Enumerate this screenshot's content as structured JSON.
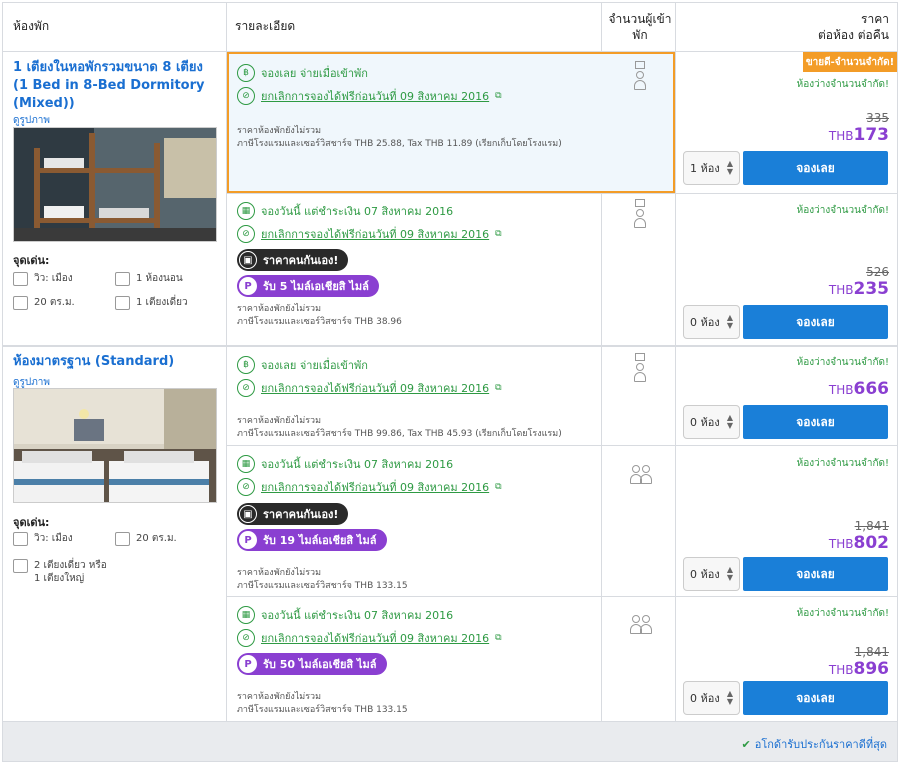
{
  "headers": {
    "room": "ห้องพัก",
    "details": "รายละเอียด",
    "guests": "จำนวนผู้เข้าพัก",
    "price_line1": "ราคา",
    "price_line2": "ต่อห้อง ต่อคืน"
  },
  "rooms": [
    {
      "title": "1 เตียงในหอพักรวมขนาด 8 เตียง (1 Bed in 8-Bed Dormitory (Mixed))",
      "photos_link": "ดูรูปภาพ",
      "features_title": "จุดเด่น:",
      "features": [
        "วิว: เมือง",
        "1 ห้องนอน",
        "20 ตร.ม.",
        "1 เตียงเดี่ยว"
      ]
    },
    {
      "title": "ห้องมาตรฐาน (Standard)",
      "photos_link": "ดูรูปภาพ",
      "features_title": "จุดเด่น:",
      "features": [
        "วิว: เมือง",
        "20 ตร.ม.",
        "2 เตียงเดี่ยว หรือ 1 เตียงใหญ่"
      ]
    }
  ],
  "offers": [
    {
      "opt1": "จองเลย จ่ายเมื่อเข้าพัก",
      "opt2": "ยกเลิกการจองได้ฟรีก่อนวันที่ 09 สิงหาคม 2016",
      "fine1": "ราคาห้องพักยังไม่รวม",
      "fine2": "ภาษีโรงแรมและเซอร์วิสชาร์จ THB 25.88, Tax THB 11.89 (เรียกเก็บโดยโรงแรม)",
      "badge": "ขายดี-จำนวนจำกัด!",
      "avail": "ห้องว่างจำนวนจำกัด!",
      "old_price": "335",
      "currency": "THB",
      "price": "173",
      "qty": "1 ห้อง",
      "button": "จองเลย"
    },
    {
      "opt1": "จองวันนี้ แต่ชำระเงิน 07 สิงหาคม 2016",
      "opt2": "ยกเลิกการจองได้ฟรีก่อนวันที่ 09 สิงหาคม 2016",
      "pill_dark": "ราคาคนกันเอง!",
      "pill_purple": "รับ 5 ไมล์เอเชียสิ ไมล์",
      "fine1": "ราคาห้องพักยังไม่รวม",
      "fine2": "ภาษีโรงแรมและเซอร์วิสชาร์จ THB 38.96",
      "avail": "ห้องว่างจำนวนจำกัด!",
      "old_price": "526",
      "currency": "THB",
      "price": "235",
      "qty": "0 ห้อง",
      "button": "จองเลย"
    },
    {
      "opt1": "จองเลย จ่ายเมื่อเข้าพัก",
      "opt2": "ยกเลิกการจองได้ฟรีก่อนวันที่ 09 สิงหาคม 2016",
      "fine1": "ราคาห้องพักยังไม่รวม",
      "fine2": "ภาษีโรงแรมและเซอร์วิสชาร์จ THB 99.86, Tax THB 45.93 (เรียกเก็บโดยโรงแรม)",
      "avail": "ห้องว่างจำนวนจำกัด!",
      "currency": "THB",
      "price": "666",
      "qty": "0 ห้อง",
      "button": "จองเลย"
    },
    {
      "opt1": "จองวันนี้ แต่ชำระเงิน 07 สิงหาคม 2016",
      "opt2": "ยกเลิกการจองได้ฟรีก่อนวันที่ 09 สิงหาคม 2016",
      "pill_dark": "ราคาคนกันเอง!",
      "pill_purple": "รับ 19 ไมล์เอเชียสิ ไมล์",
      "fine1": "ราคาห้องพักยังไม่รวม",
      "fine2": "ภาษีโรงแรมและเซอร์วิสชาร์จ THB 133.15",
      "avail": "ห้องว่างจำนวนจำกัด!",
      "old_price": "1,841",
      "currency": "THB",
      "price": "802",
      "qty": "0 ห้อง",
      "button": "จองเลย"
    },
    {
      "opt1": "จองวันนี้ แต่ชำระเงิน 07 สิงหาคม 2016",
      "opt2": "ยกเลิกการจองได้ฟรีก่อนวันที่ 09 สิงหาคม 2016",
      "pill_purple": "รับ 50 ไมล์เอเชียสิ ไมล์",
      "fine1": "ราคาห้องพักยังไม่รวม",
      "fine2": "ภาษีโรงแรมและเซอร์วิสชาร์จ THB 133.15",
      "avail": "ห้องว่างจำนวนจำกัด!",
      "old_price": "1,841",
      "currency": "THB",
      "price": "896",
      "qty": "0 ห้อง",
      "button": "จองเลย"
    }
  ],
  "footer": {
    "guarantee": "อโกด้ารับประกันราคาดีที่สุด"
  },
  "colors": {
    "accent_blue": "#1a7fd8",
    "green": "#2e9a43",
    "purple": "#8a3fd1",
    "badge_orange": "#f39c27"
  }
}
